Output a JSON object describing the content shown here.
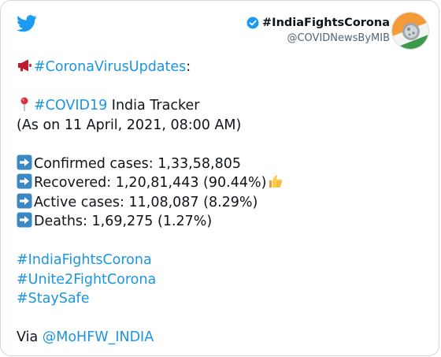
{
  "header": {
    "account_name": "#IndiaFightsCorona",
    "account_handle": "@COVIDNewsByMIB"
  },
  "tweet": {
    "hashtag_updates": "#CoronaVirusUpdates",
    "colon": ":",
    "tracker_hashtag": "#COVID19",
    "tracker_text": " India Tracker",
    "as_on": "(As on 11 April, 2021, 08:00 AM)",
    "confirmed": "Confirmed cases: 1,33,58,805",
    "recovered": "Recovered: 1,20,81,443 (90.44%)",
    "active": "Active cases: 11,08,087 (8.29%)",
    "deaths": "Deaths: 1,69,275 (1.27%)",
    "tag1": "#IndiaFightsCorona",
    "tag2": "#Unite2FightCorona",
    "tag3": "#StaySafe",
    "via_label": "Via ",
    "via_mention": "@MoHFW_INDIA"
  },
  "icons": {
    "bird": "twitter-bird-icon",
    "verified": "verified-badge-icon",
    "megaphone": "megaphone-icon",
    "pin": "round-pushpin-icon",
    "arrow": "right-arrow-icon",
    "thumbs": "thumbs-up-icon"
  },
  "colors": {
    "twitter_blue": "#1d9bf0",
    "link_blue": "#1b95e0",
    "arrow_box": "#3b88c3",
    "text": "#0f1419",
    "muted": "#536471"
  }
}
